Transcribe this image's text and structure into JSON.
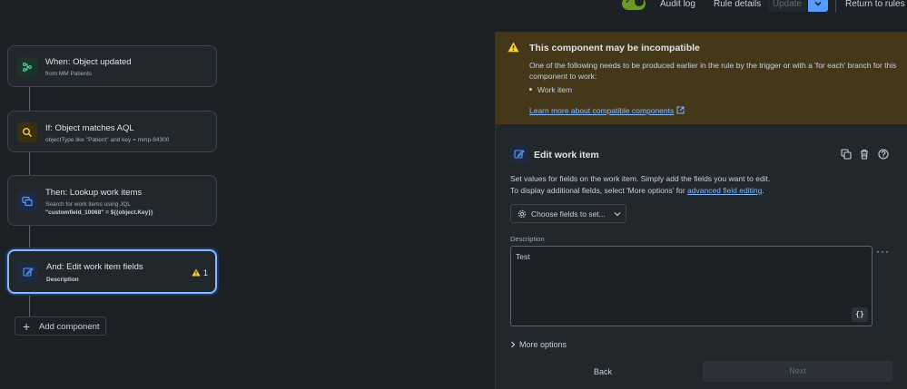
{
  "topbar": {
    "audit_log": "Audit log",
    "rule_details": "Rule details",
    "update": "Update",
    "return": "Return to rules"
  },
  "colors": {
    "background": "#1d2125",
    "accent_blue": "#579dff",
    "toggle_green": "#6a9a23",
    "warning_bg": "#45381a",
    "warning_yellow": "#f5cd47",
    "node_trigger_green": "#4bce97",
    "node_condition_yellow": "#f5cd47",
    "node_action_blue": "#579dff"
  },
  "flow": {
    "nodes": [
      {
        "title": "When: Object updated",
        "sub": "from MM Patients",
        "icon": "branch-icon"
      },
      {
        "title": "If: Object matches AQL",
        "sub": "objectType like \"Patient\" and key = mmp-84300",
        "icon": "search-icon"
      },
      {
        "title": "Then: Lookup work items",
        "sub": "Search for work items using JQL",
        "sub2": "\"customfield_10068\" = ${{object.Key}}",
        "icon": "lookup-icon"
      },
      {
        "title": "And: Edit work item fields",
        "sub": "Description",
        "icon": "edit-icon",
        "warning_count": "1"
      }
    ],
    "add_component": "Add component"
  },
  "panel": {
    "warning": {
      "title": "This component may be incompatible",
      "desc": "One of the following needs to be produced earlier in the rule by the trigger or with a 'for each' branch for this component to work:",
      "bullet": "Work item",
      "link": "Learn more about compatible components"
    },
    "edit": {
      "title": "Edit work item",
      "desc_line1": "Set values for fields on the work item. Simply add the fields you want to edit.",
      "desc_line2_prefix": "To display additional fields, select 'More options' for ",
      "desc_link": "advanced field editing",
      "desc_line2_suffix": ".",
      "choose_fields": "Choose fields to set...",
      "field_label": "Description",
      "field_value": "Test",
      "braces": "{}",
      "more_options": "More options",
      "back": "Back",
      "next": "Next"
    }
  }
}
